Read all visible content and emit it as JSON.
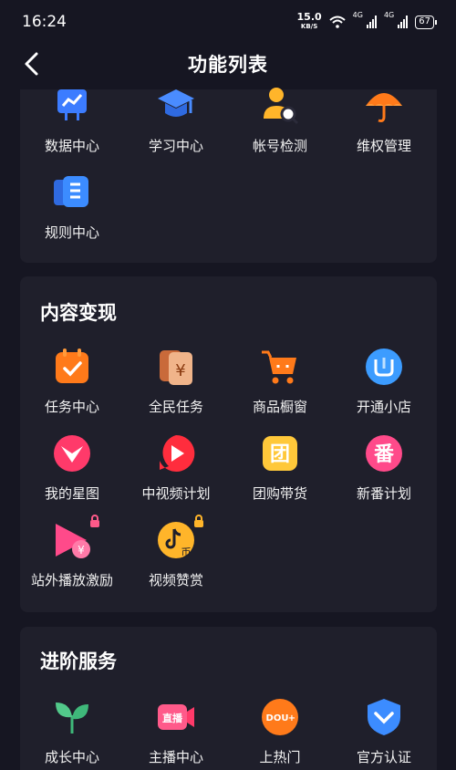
{
  "status_bar": {
    "time": "16:24",
    "speed_value": "15.0",
    "speed_unit": "KB/S",
    "net1": "4G",
    "net2": "4G",
    "battery": "67"
  },
  "nav": {
    "title": "功能列表"
  },
  "section1": {
    "items": [
      {
        "label": "数据中心",
        "icon": "chart-board-icon"
      },
      {
        "label": "学习中心",
        "icon": "graduation-cap-icon"
      },
      {
        "label": "帐号检测",
        "icon": "user-search-icon"
      },
      {
        "label": "维权管理",
        "icon": "umbrella-icon"
      },
      {
        "label": "规则中心",
        "icon": "rules-book-icon"
      }
    ]
  },
  "section2": {
    "title": "内容变现",
    "items": [
      {
        "label": "任务中心",
        "icon": "task-calendar-icon"
      },
      {
        "label": "全民任务",
        "icon": "yuan-card-icon"
      },
      {
        "label": "商品橱窗",
        "icon": "shopping-cart-icon"
      },
      {
        "label": "开通小店",
        "icon": "shop-bag-icon"
      },
      {
        "label": "我的星图",
        "icon": "star-map-icon"
      },
      {
        "label": "中视频计划",
        "icon": "video-play-icon"
      },
      {
        "label": "团购带货",
        "icon": "group-buy-icon"
      },
      {
        "label": "新番计划",
        "icon": "new-anime-icon"
      },
      {
        "label": "站外播放激励",
        "icon": "external-play-icon",
        "locked": true
      },
      {
        "label": "视频赞赏",
        "icon": "tiktok-coin-icon",
        "locked": true
      }
    ]
  },
  "section3": {
    "title": "进阶服务",
    "items": [
      {
        "label": "成长中心",
        "icon": "sprout-icon"
      },
      {
        "label": "主播中心",
        "icon": "live-camera-icon"
      },
      {
        "label": "上热门",
        "icon": "dou-plus-icon"
      },
      {
        "label": "官方认证",
        "icon": "verified-shield-icon"
      }
    ]
  },
  "icon_text": {
    "yuan": "¥",
    "tuan": "团",
    "fan": "番",
    "bi": "币",
    "zhibo": "直播",
    "dou": "DOU",
    "plus": "+"
  },
  "colors": {
    "background": "#161622",
    "card": "#1f1f2b",
    "orange": "#ff7a1a",
    "blue": "#3c8cff",
    "pink": "#ff3a7a",
    "red": "#ff2d3d",
    "green": "#52c98a",
    "yellow": "#ffc83a"
  }
}
